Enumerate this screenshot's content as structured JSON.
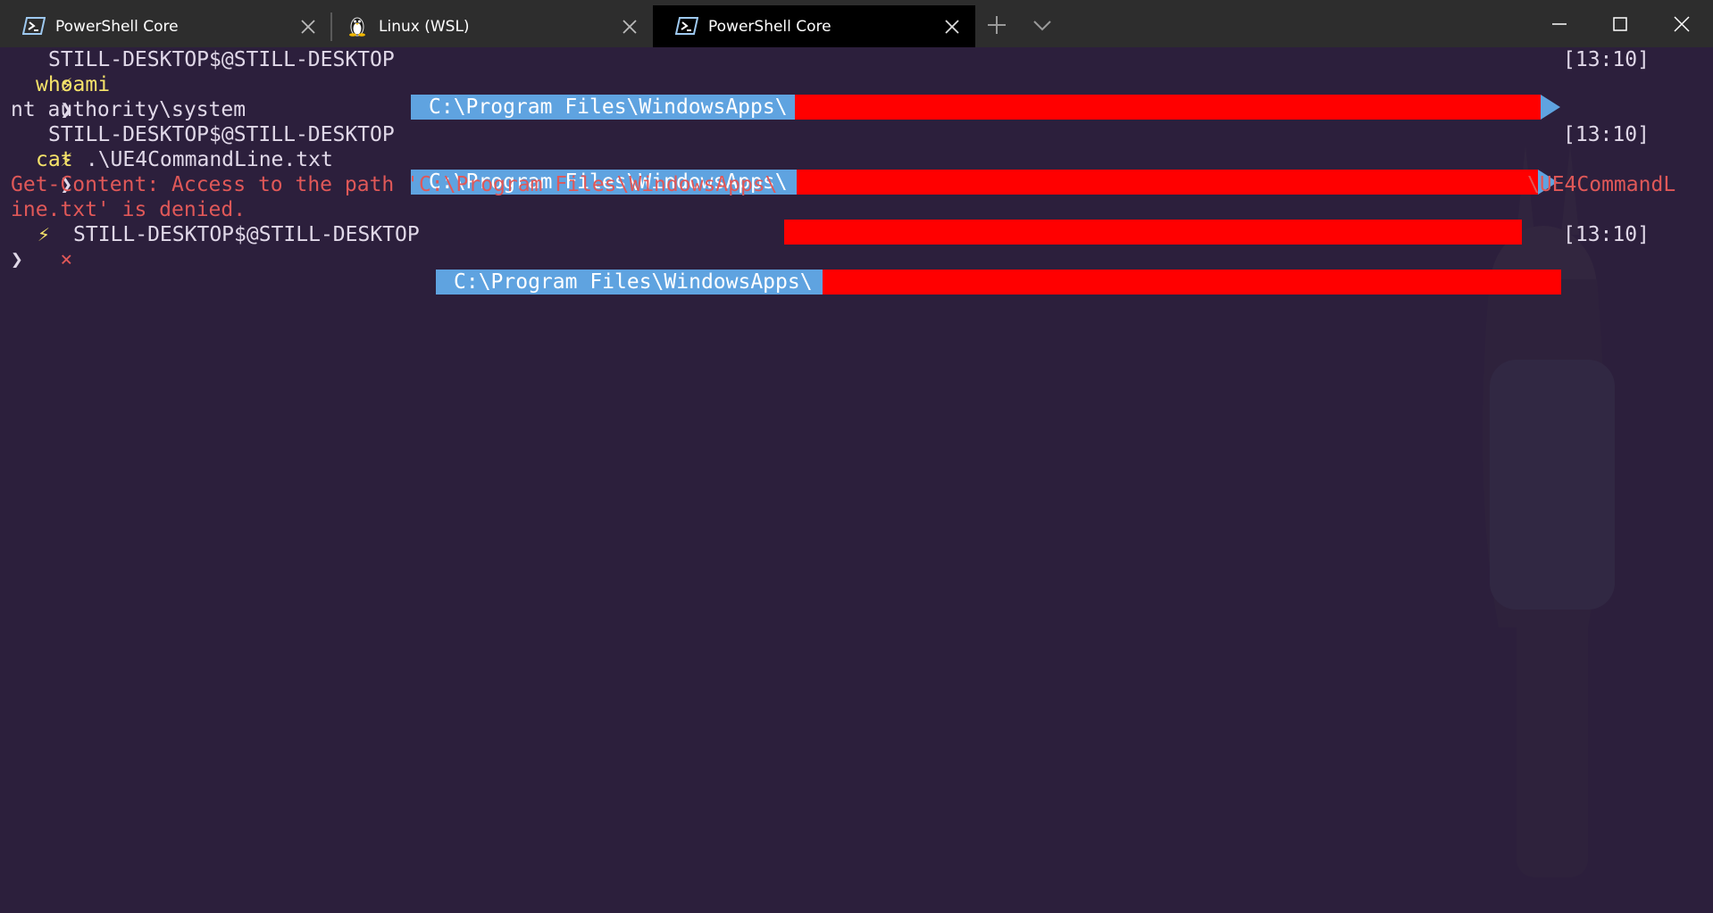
{
  "tabs": [
    {
      "label": "PowerShell Core",
      "icon": "powershell-icon",
      "active": false
    },
    {
      "label": "Linux (WSL)",
      "icon": "linux-penguin-icon",
      "active": false
    },
    {
      "label": "PowerShell Core",
      "icon": "powershell-icon",
      "active": true
    }
  ],
  "terminal": {
    "prompt_user": "STILL-DESKTOP$@STILL-DESKTOP",
    "path": "C:\\Program Files\\WindowsApps\\",
    "time": "[13:10]",
    "prompt_char": "❯",
    "lightning": "⚡",
    "error_mark": "×",
    "cmd1": "whoami",
    "out1": "nt authority\\system",
    "cmd2_verb": "cat",
    "cmd2_arg": " .\\UE4CommandLine.txt",
    "err_line1_a": "Get-Content: Access to the path 'C:\\Program Files\\WindowsApps\\",
    "err_line1_b": "\\UE4CommandL",
    "err_line2": "ine.txt' is denied."
  },
  "colors": {
    "background": "#2c1f3c",
    "path_segment": "#5fa3e0",
    "redaction": "#ff0000",
    "error_text": "#e05858",
    "command_text": "#f6e36a"
  }
}
